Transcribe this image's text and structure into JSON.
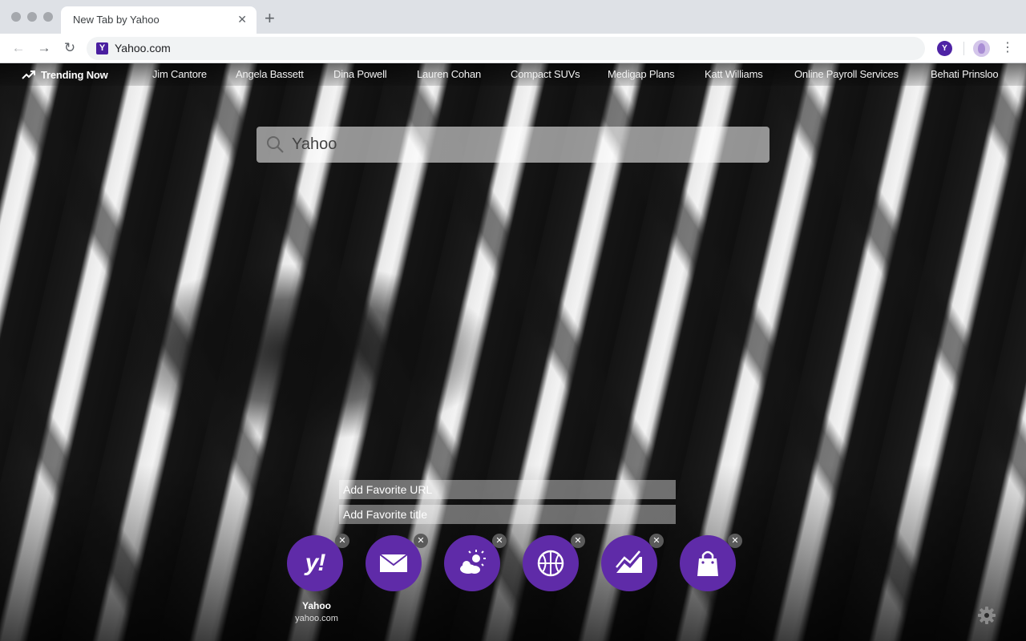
{
  "browser": {
    "tab_title": "New Tab by Yahoo",
    "tab_close": "✕",
    "new_tab": "+",
    "url": "Yahoo.com",
    "site_favicon_letter": "Y",
    "extension_letter": "Y",
    "nav": {
      "back": "←",
      "forward": "→",
      "reload": "↻",
      "menu": "⋮"
    }
  },
  "trending": {
    "label": "Trending Now",
    "items": [
      "Jim Cantore",
      "Angela Bassett",
      "Dina Powell",
      "Lauren Cohan",
      "Compact SUVs",
      "Medigap Plans",
      "Katt Williams",
      "Online Payroll Services",
      "Behati Prinsloo"
    ]
  },
  "search": {
    "placeholder": "Yahoo"
  },
  "favorites_form": {
    "url_placeholder": "Add Favorite URL",
    "title_placeholder": "Add Favorite title"
  },
  "tiles": [
    {
      "icon": "yahoo-logo",
      "glyph": "y!",
      "name": "Yahoo",
      "domain": "yahoo.com"
    },
    {
      "icon": "mail-icon"
    },
    {
      "icon": "weather-icon"
    },
    {
      "icon": "sports-icon"
    },
    {
      "icon": "finance-icon"
    },
    {
      "icon": "shopping-icon"
    }
  ],
  "tile_close_glyph": "✕",
  "colors": {
    "accent": "#5f2ba8",
    "favicon": "#4a1fa0"
  }
}
